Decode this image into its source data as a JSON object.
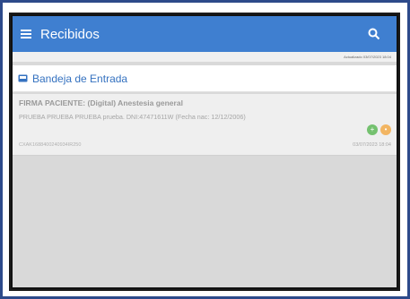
{
  "appbar": {
    "title": "Recibidos",
    "menu_icon": "hamburger-menu-icon",
    "search_icon": "search-icon"
  },
  "sync": {
    "text": "Actualizado 03/07/2023 18:04"
  },
  "section": {
    "title": "Bandeja de Entrada",
    "icon": "inbox-icon"
  },
  "message": {
    "subject": "FIRMA PACIENTE: (Digital) Anestesia general",
    "body": "PRUEBA PRUEBA PRUEBA prueba. DNI:47471611W (Fecha nac: 12/12/2006)",
    "id": "CXAK1688400240934IR250",
    "date": "03/07/2023 18:04",
    "badges": [
      {
        "icon": "green-status-icon",
        "color": "#74c16f"
      },
      {
        "icon": "orange-status-icon",
        "color": "#f2b562"
      }
    ]
  },
  "colors": {
    "appbar": "#3f7fd0",
    "accent": "#3572c0"
  }
}
